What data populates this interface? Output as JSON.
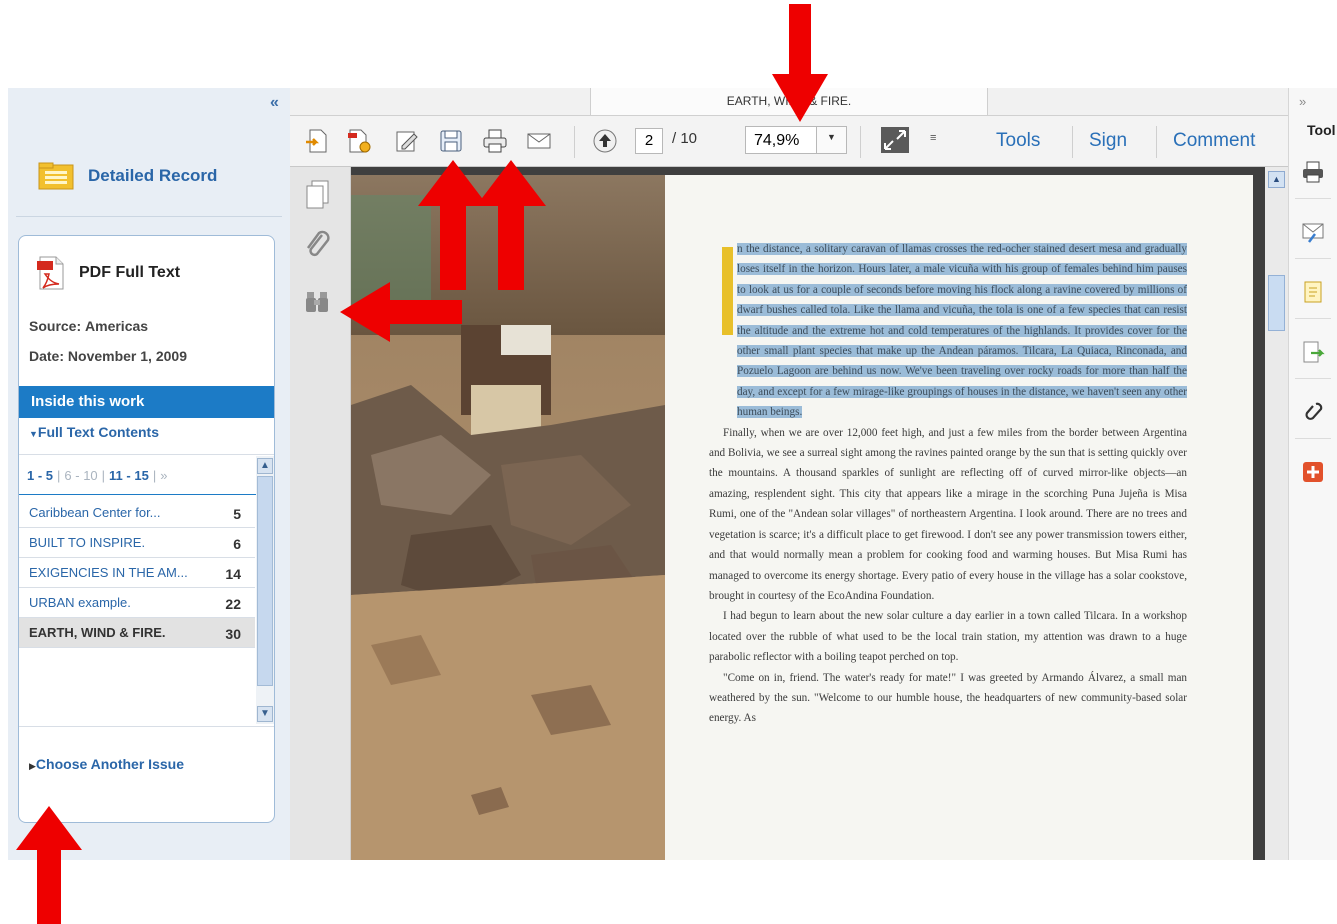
{
  "sidebar": {
    "collapse_symbol": "«",
    "detailed_record": "Detailed Record",
    "pdf_full_text": "PDF Full Text",
    "source_label": "Source:",
    "source_value": "Americas",
    "date_label": "Date:",
    "date_value": "November 1,  2009",
    "inside_work": "Inside this work",
    "full_text_contents": "Full Text Contents",
    "pager": {
      "p1": "1 - 5",
      "p2": "6 - 10",
      "p3": "11 - 15",
      "more": "»"
    },
    "toc": [
      {
        "title": "Caribbean Center for...",
        "page": "5"
      },
      {
        "title": "BUILT TO INSPIRE.",
        "page": "6"
      },
      {
        "title": "EXIGENCIES IN THE AM...",
        "page": "14"
      },
      {
        "title": "URBAN example.",
        "page": "22"
      },
      {
        "title": "EARTH, WIND & FIRE.",
        "page": "30"
      }
    ],
    "choose_issue": "Choose Another Issue"
  },
  "viewer": {
    "doc_tab": "EARTH, WIND & FIRE.",
    "page_current": "2",
    "page_total": "/ 10",
    "zoom": "74,9%",
    "tools": "Tools",
    "sign": "Sign",
    "comment": "Comment"
  },
  "page_text": {
    "p1_highlighted": "n the distance, a solitary caravan of llamas crosses the red-ocher stained desert mesa and gradually loses itself in the horizon. Hours later, a male vicuña with his group of females behind him pauses to look at us for a couple of seconds before moving his flock along a ravine covered by millions of dwarf bushes called tola. Like the llama and vicuña, the tola is one of a few species that can resist the altitude and the extreme hot and cold temperatures of the highlands. It provides cover for the other small plant species that make up the Andean páramos. Tilcara, La Quiaca, Rinconada, and Pozuelo Lagoon are behind us now. We've been traveling over rocky roads for more than half the day, and except for a few mirage-like groupings of houses in the distance, we haven't seen any other human beings.",
    "p2": "Finally, when we are over 12,000 feet high, and just a few miles from the border between Argentina and Bolivia, we see a surreal sight among the ravines painted orange by the sun that is setting quickly over the mountains. A thousand sparkles of sunlight are reflecting off of curved mirror-like objects—an amazing, resplendent sight. This city that appears like a mirage in the scorching Puna Jujeña is Misa Rumi, one of the \"Andean solar villages\" of northeastern Argentina. I look around. There are no trees and vegetation is scarce; it's a difficult place to get firewood. I don't see any power transmission towers either, and that would normally mean a problem for cooking food and warming houses. But Misa Rumi has managed to overcome its energy shortage. Every patio of every house in the village has a solar cookstove, brought in courtesy of the EcoAndina Foundation.",
    "p3": "I had begun to learn about the new solar culture a day earlier in a town called Tilcara. In a workshop located over the rubble of what used to be the local train station, my attention was drawn to a huge parabolic reflector with a boiling teapot perched on top.",
    "p4": "\"Come on in, friend. The water's ready for mate!\" I was greeted by Armando Álvarez, a small man weathered by the sun. \"Welcome to our humble house, the headquarters of new community-based solar energy. As"
  },
  "right_pane": {
    "collapse_symbol": "»",
    "title": "Tool"
  },
  "colors": {
    "accent_blue": "#1c7bc6",
    "link_blue": "#2a66a8",
    "arrow_red": "#ee0000",
    "highlight": "#9bbcd8"
  }
}
